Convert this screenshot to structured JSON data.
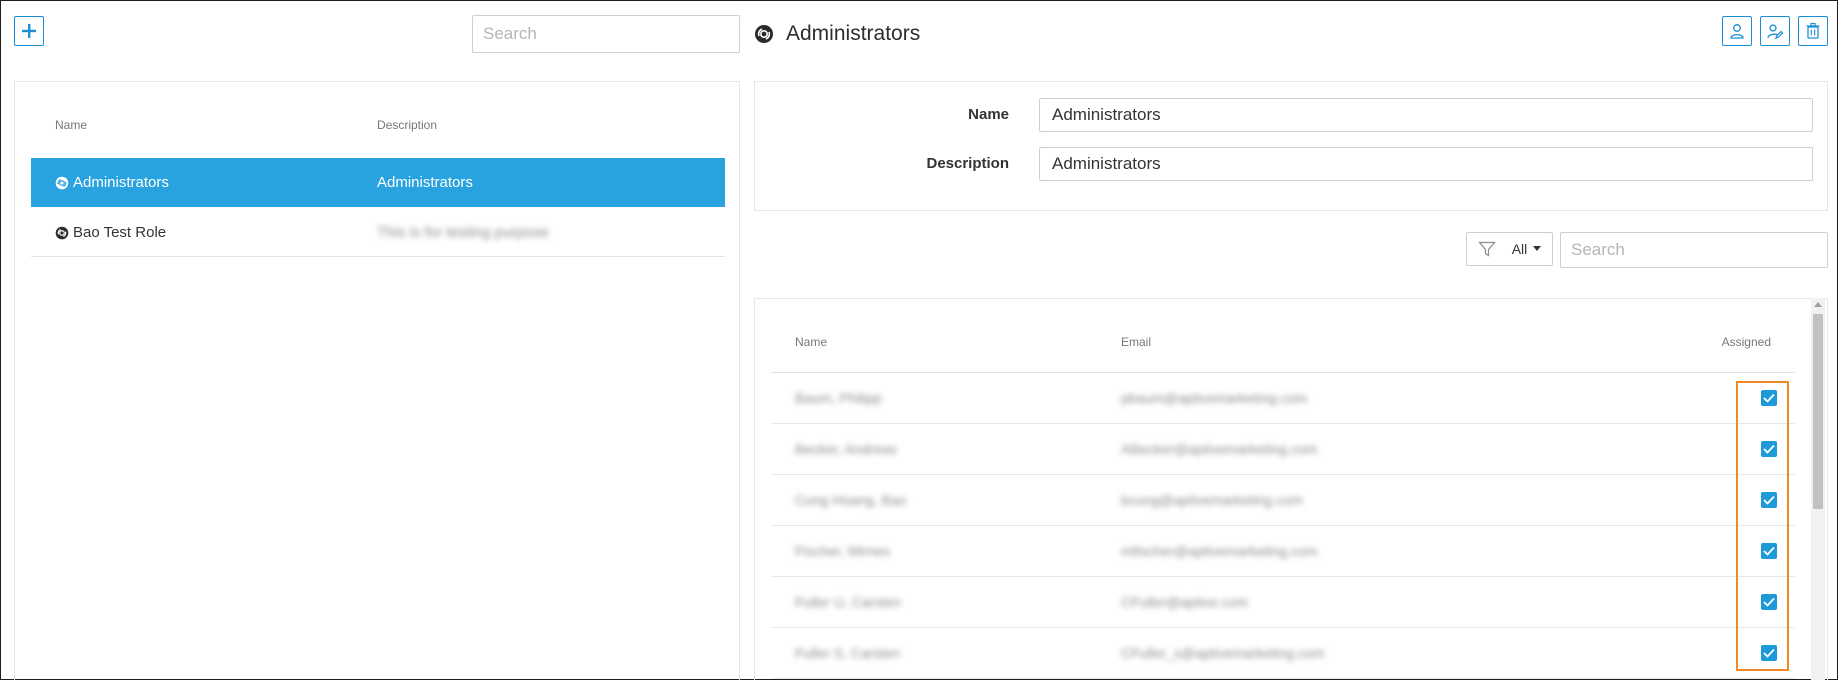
{
  "toolbar": {
    "add_icon": "plus-icon",
    "left_search_placeholder": "Search",
    "title": "Administrators",
    "title_icon": "role-disc-icon",
    "actions": [
      "assign-user-icon",
      "edit-user-icon",
      "trash-icon"
    ]
  },
  "roles_table": {
    "columns": [
      "Name",
      "Description"
    ],
    "rows": [
      {
        "name": "Administrators",
        "description": "Administrators",
        "selected": true
      },
      {
        "name": "Bao Test Role",
        "description": "This is for testing purpose",
        "selected": false
      }
    ]
  },
  "details": {
    "name_label": "Name",
    "name_value": "Administrators",
    "description_label": "Description",
    "description_value": "Administrators"
  },
  "filter": {
    "icon": "filter-icon",
    "label": "All",
    "search_placeholder": "Search"
  },
  "users_table": {
    "columns": [
      "Name",
      "Email",
      "Assigned"
    ],
    "rows": [
      {
        "name": "Baum, Philipp",
        "email": "pbaum@aptivemarketing.com",
        "assigned": true
      },
      {
        "name": "Becker, Andreas",
        "email": "ABecker@aptivemarketing.com",
        "assigned": true
      },
      {
        "name": "Cung Hoang, Bao",
        "email": "bcung@aptivemarketing.com",
        "assigned": true
      },
      {
        "name": "Fischer, Mirnes",
        "email": "mfischer@aptivemarketing.com",
        "assigned": true
      },
      {
        "name": "Fuller U, Carsten",
        "email": "CFuller@aptive.com",
        "assigned": true
      },
      {
        "name": "Fuller S, Carsten",
        "email": "CFuller_s@aptivemarketing.com",
        "assigned": true
      }
    ]
  },
  "colors": {
    "accent": "#1a8fd6",
    "selected_row": "#29a3e0",
    "highlight": "#f08a24"
  }
}
